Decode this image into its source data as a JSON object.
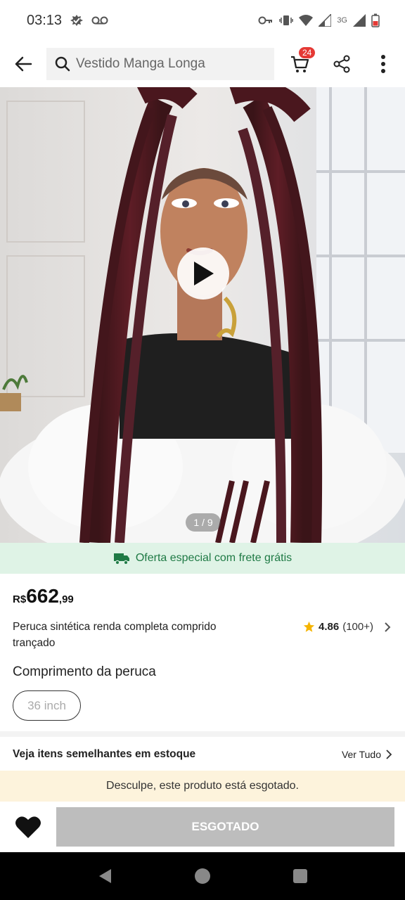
{
  "status_bar": {
    "time": "03:13",
    "network_type": "3G"
  },
  "header": {
    "search_text": "Vestido Manga Longa",
    "cart_count": "24"
  },
  "hero": {
    "pager": "1 / 9"
  },
  "shipping_banner": {
    "text": "Oferta especial com frete grátis",
    "color": "#1f7a45"
  },
  "product": {
    "currency": "R$",
    "price_int": "662",
    "price_dec": ",99",
    "title": "Peruca sintética renda completa comprido trançado",
    "rating": "4.86",
    "rating_count": "(100+)",
    "option_label": "Comprimento da peruca",
    "option_value": "36 inch"
  },
  "similar": {
    "title": "Veja itens semelhantes em estoque",
    "see_all": "Ver Tudo"
  },
  "soldout": {
    "banner_text": "Desculpe, este produto está esgotado.",
    "button_label": "ESGOTADO"
  },
  "icons": [
    "back-arrow-icon",
    "search-icon",
    "cart-icon",
    "share-icon",
    "more-vert-icon",
    "play-icon",
    "truck-icon",
    "star-icon",
    "chevron-right-icon",
    "heart-icon",
    "nav-back-icon",
    "nav-home-icon",
    "nav-recents-icon"
  ]
}
